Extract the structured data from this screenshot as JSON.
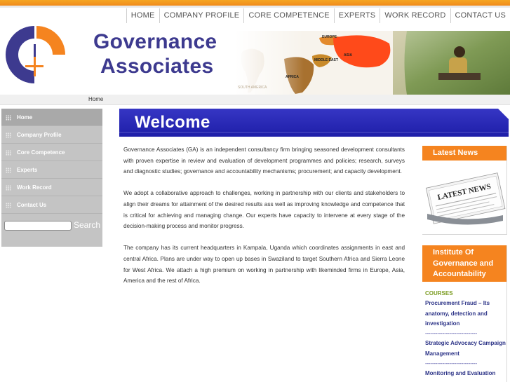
{
  "nav": {
    "items": [
      {
        "label": "HOME"
      },
      {
        "label": "COMPANY PROFILE"
      },
      {
        "label": "CORE COMPETENCE"
      },
      {
        "label": "EXPERTS"
      },
      {
        "label": "WORK RECORD"
      },
      {
        "label": "CONTACT US"
      }
    ]
  },
  "brand": {
    "line1": "Governance",
    "line2": "Associates",
    "color": "#3d3a8f",
    "logo_icon": "ga-logo-icon"
  },
  "banner": {
    "map_labels": [
      "EUROPE",
      "MIDDLE EAST",
      "ASIA",
      "AFRICA",
      "SOUTH AMERICA"
    ]
  },
  "breadcrumb": {
    "text": "Home"
  },
  "sidebar": {
    "items": [
      {
        "label": "Home",
        "active": true
      },
      {
        "label": "Company Profile"
      },
      {
        "label": "Core Competence"
      },
      {
        "label": "Experts"
      },
      {
        "label": "Work Record"
      },
      {
        "label": "Contact Us"
      }
    ],
    "search_value": "",
    "search_button": "Search"
  },
  "main": {
    "title": "Welcome",
    "paragraphs": [
      "Governance Associates (GA) is an independent consultancy firm bringing seasoned development consultants with proven expertise in review and evaluation of development programmes and policies; research, surveys and diagnostic studies; governance and accountability mechanisms; procurement; and capacity development.",
      "We adopt a collaborative approach to challenges, working in partnership with our clients and stakeholders to align their dreams for attainment of the desired results ass well as improving knowledge and competence that is critical for achieving and managing change. Our experts have capacity to intervene at every stage of the decision-making process and monitor progress.",
      "The company has its current headquarters in Kampala, Uganda which coordinates assignments in east and central Africa. Plans are under way to open up bases in Swaziland to target Southern Africa and Sierra Leone for West Africa. We attach a high premium on working in partnership with likeminded firms in Europe, Asia, America and the rest of Africa."
    ]
  },
  "news": {
    "title": "Latest News",
    "image_text": "LATEST NEWS"
  },
  "institute": {
    "title": "Institute Of Governance and Accountability",
    "courses_label": "COURSES",
    "separator": "------------------------------",
    "courses": [
      "Procurement Fraud – Its anatomy, detection and investigation",
      "Strategic Advocacy Campaign Management",
      "Monitoring and Evaluation"
    ]
  },
  "colors": {
    "accent_orange": "#f5841f",
    "brand_blue": "#3d3a8f",
    "welcome_bar": "#2a2ab5",
    "sidebar_gray": "#c4c4c4"
  }
}
